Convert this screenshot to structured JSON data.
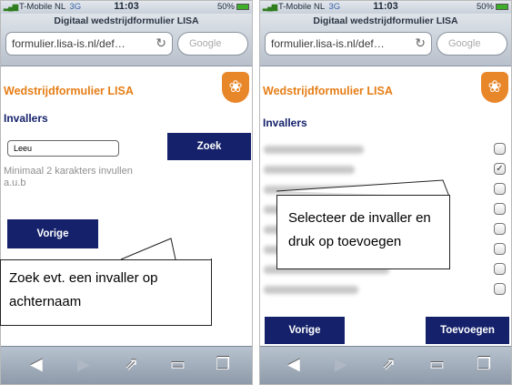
{
  "left_screen": {
    "status": {
      "carrier": "T-Mobile NL",
      "network": "3G",
      "time": "11:03",
      "battery": "50%"
    },
    "browser": {
      "title": "Digitaal wedstrijdformulier LISA",
      "url": "formulier.lisa-is.nl/def…",
      "search_placeholder": "Google"
    },
    "page": {
      "title": "Wedstrijdformulier LISA",
      "section_heading": "Invallers",
      "search_value": "Leeu",
      "search_button": "Zoek",
      "hint": "Minimaal 2 karakters invullen a.u.b",
      "back_button": "Vorige"
    },
    "callout": "Zoek evt. een invaller op achternaam"
  },
  "right_screen": {
    "status": {
      "carrier": "T-Mobile NL",
      "network": "3G",
      "time": "11:03",
      "battery": "50%"
    },
    "browser": {
      "title": "Digitaal wedstrijdformulier LISA",
      "url": "formulier.lisa-is.nl/def…",
      "search_placeholder": "Google"
    },
    "page": {
      "title": "Wedstrijdformulier LISA",
      "section_heading": "Invallers",
      "invallers": [
        {
          "checked": false
        },
        {
          "checked": true
        },
        {
          "checked": false
        },
        {
          "checked": false
        },
        {
          "checked": false
        },
        {
          "checked": false
        },
        {
          "checked": false
        },
        {
          "checked": false
        }
      ],
      "back_button": "Vorige",
      "add_button": "Toevoegen"
    },
    "callout": "Selecteer de invaller en druk op toevoegen"
  },
  "icons": {
    "back": "back-arrow-icon",
    "forward": "forward-arrow-icon",
    "share": "share-icon",
    "bookmarks": "bookmarks-icon",
    "pages": "pages-icon",
    "reload": "reload-icon",
    "logo": "lisa-logo-icon"
  },
  "colors": {
    "accent_orange": "#e67e17",
    "button_navy": "#15226b",
    "toolbar": "#9aa5b3"
  }
}
